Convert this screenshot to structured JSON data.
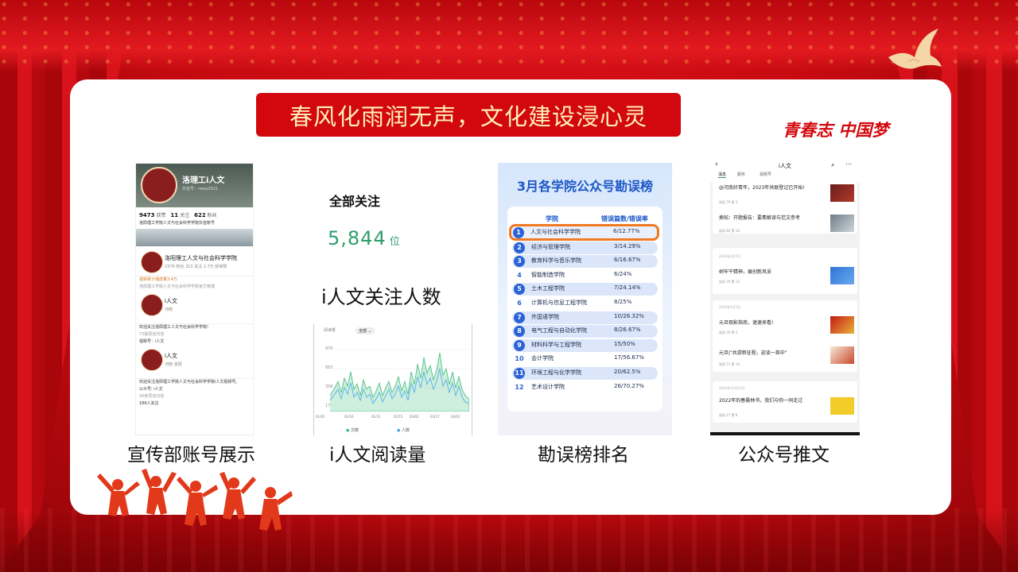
{
  "slide": {
    "title": "春风化雨润无声，文化建设浸心灵",
    "slogan": "青春志 中国梦",
    "colors": {
      "accent_red": "#d3080f",
      "banner_text": "#fff1b5",
      "card_bg": "#ffffff"
    }
  },
  "panels": {
    "account": {
      "caption": "宣传部账号展示",
      "profile_name": "洛理工i人文",
      "profile_id": "抖音号：neep2021",
      "stats": [
        {
          "value": "9473",
          "label": "获赞"
        },
        {
          "value": "11",
          "label": "关注"
        },
        {
          "value": "622",
          "label": "粉丝"
        }
      ],
      "bio": "洛阳理工学院人文与社会科学学院抖音账号",
      "college_name": "洛阳理工人文与社会科学学院",
      "college_stats": [
        {
          "value": "2379",
          "label": "粉丝"
        },
        {
          "value": "313",
          "label": "关注"
        },
        {
          "value": "2.7万",
          "label": "获得赞"
        }
      ],
      "note1": "视频累计播放量3.4万",
      "note2": "洛阳理工学院人文与社会科学学院官方微博",
      "items": [
        {
          "name": "i人文",
          "sub": "河南",
          "desc": "欢迎关注洛阳理工人文与社会科学学院!",
          "meta": "73篇原创内容",
          "tag": "视频号：i人文"
        },
        {
          "name": "i人文",
          "sub": "河南 洛阳",
          "desc": "欢迎关注洛阳理工学院人文与社会科学学院i人文视频号。",
          "meta": "公众号: i人文",
          "extra": "56条原创内容",
          "follow": "186人关注"
        }
      ],
      "legend_a": "",
      "legend_b": ""
    },
    "reading": {
      "all_follow_label": "全部关注",
      "follow_count": "5,844",
      "follow_unit": "位",
      "title": "i人文关注人数",
      "caption": "i人文阅读量",
      "chart_filter": "全部",
      "chart_label": "阅读量",
      "legend": [
        "次数",
        "人数"
      ]
    },
    "ranking": {
      "caption": "勘误榜排名",
      "title": "3月各学院公众号勘误榜",
      "col_college": "学院",
      "col_errors": "错误篇数/错误率",
      "rows": [
        {
          "rank": "1",
          "name": "人文与社会科学学院",
          "value": "6/12.77%"
        },
        {
          "rank": "2",
          "name": "经济与管理学院",
          "value": "3/14.29%"
        },
        {
          "rank": "3",
          "name": "教育科学与音乐学院",
          "value": "6/16.67%"
        },
        {
          "rank": "4",
          "name": "智能制造学院",
          "value": "6/24%"
        },
        {
          "rank": "5",
          "name": "土木工程学院",
          "value": "7/24.14%"
        },
        {
          "rank": "6",
          "name": "计算机与信息工程学院",
          "value": "8/25%"
        },
        {
          "rank": "7",
          "name": "外国语学院",
          "value": "10/26.32%"
        },
        {
          "rank": "8",
          "name": "电气工程与自动化学院",
          "value": "8/26.67%"
        },
        {
          "rank": "9",
          "name": "材料科学与工程学院",
          "value": "15/50%"
        },
        {
          "rank": "10",
          "name": "会计学院",
          "value": "17/56.67%"
        },
        {
          "rank": "11",
          "name": "环境工程与化学学院",
          "value": "20/62.5%"
        },
        {
          "rank": "12",
          "name": "艺术设计学院",
          "value": "26/70.27%"
        }
      ]
    },
    "articles": {
      "caption": "公众号推文",
      "header": "i人文",
      "tabs": [
        "消息",
        "服务",
        "视频号"
      ],
      "posts": [
        {
          "title": "@河南好青年，2023年共联登记已开始!",
          "meta": "阅读 79  赞 3"
        },
        {
          "title": "换帖：开题报告：要素解读与范文参考",
          "meta": "阅读 82  赞 10"
        },
        {
          "date": "2023年1月2日",
          "title": "树牢干精神，展创新风采",
          "meta": "阅读 20  赞 13"
        },
        {
          "date": "2023年1月1日",
          "title": "元旦观影指南，速速来看!",
          "meta": "阅读 30  赞 3"
        },
        {
          "title": "元旦|\"共游新征程，迎谈一首中\"",
          "meta": "阅读 71  赞 14"
        },
        {
          "date": "2022年12月31日",
          "title": "2022年的春晨林书，我们与你一同走过",
          "meta": "阅读 27  赞 8"
        }
      ]
    }
  }
}
